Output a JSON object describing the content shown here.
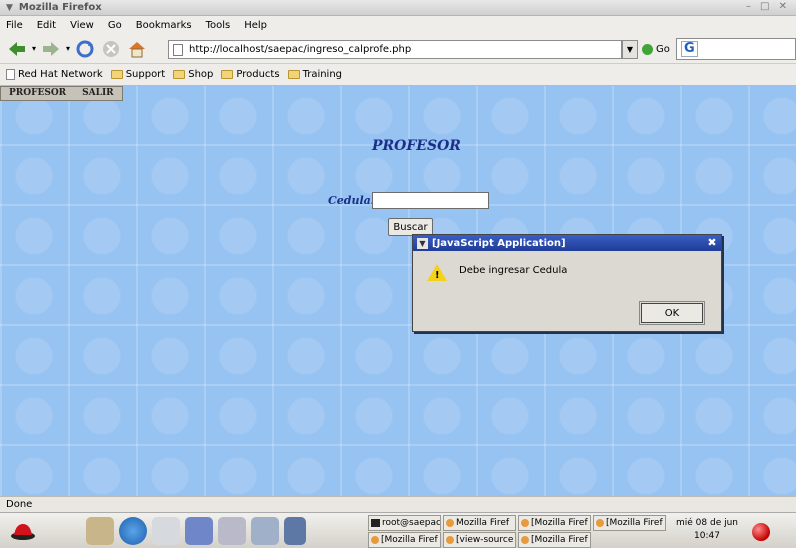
{
  "window": {
    "title": "Mozilla Firefox"
  },
  "menubar": {
    "items": [
      "File",
      "Edit",
      "View",
      "Go",
      "Bookmarks",
      "Tools",
      "Help"
    ]
  },
  "navbar": {
    "url": "http://localhost/saepac/ingreso_calprofe.php",
    "go_label": "Go"
  },
  "bookmarks": {
    "items": [
      "Red Hat Network",
      "Support",
      "Shop",
      "Products",
      "Training"
    ]
  },
  "page": {
    "top_menu": [
      "PROFESOR",
      "SALIR"
    ],
    "heading": "PROFESOR",
    "cedula_label": "Cedula:",
    "cedula_value": "",
    "buscar_label": "Buscar"
  },
  "dialog": {
    "title": "[JavaScript Application]",
    "message": "Debe ingresar Cedula",
    "ok_label": "OK"
  },
  "status": {
    "text": "Done"
  },
  "taskbar": {
    "tasks": [
      "root@saepac",
      "Mozilla Firef",
      "[Mozilla Firef",
      "[Mozilla Firef",
      "[Mozilla Firef",
      "[view-source",
      "[Mozilla Firef"
    ],
    "clock_date": "mié 08 de jun",
    "clock_time": "10:47"
  },
  "colors": {
    "content_bg": "#97c3f2",
    "heading": "#1b2f8a",
    "dialog_title": "#2a4aad"
  }
}
